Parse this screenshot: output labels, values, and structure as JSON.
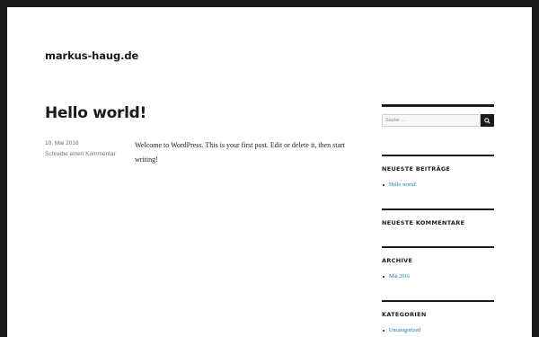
{
  "site": {
    "title": "markus-haug.de"
  },
  "post": {
    "title": "Hello world!",
    "date": "10. Mai 2016",
    "comment_link": "Schreibe einen Kommentar",
    "content": "Welcome to WordPress. This is your first post. Edit or delete it, then start writing!"
  },
  "sidebar": {
    "search": {
      "placeholder": "Suche …",
      "button_icon": "search-icon"
    },
    "recent_posts": {
      "title": "NEUESTE BEITRÄGE",
      "items": [
        "Hello world!"
      ]
    },
    "recent_comments": {
      "title": "NEUESTE KOMMENTARE"
    },
    "archive": {
      "title": "ARCHIVE",
      "items": [
        "Mai 2016"
      ]
    },
    "categories": {
      "title": "KATEGORIEN",
      "items": [
        "Uncategorized"
      ]
    }
  },
  "colors": {
    "link": "#007acc",
    "text": "#1a1a1a",
    "frame": "#1a1a1a",
    "meta": "#707070"
  }
}
